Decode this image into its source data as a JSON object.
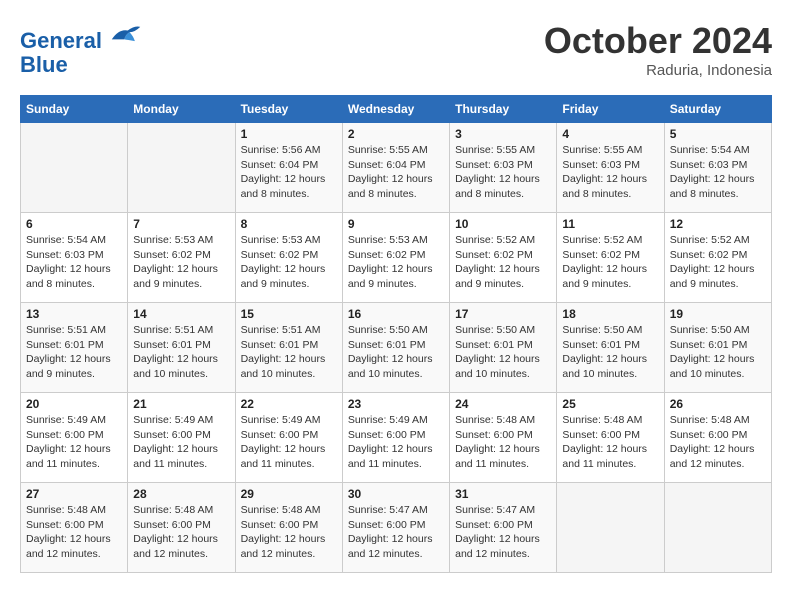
{
  "header": {
    "logo_line1": "General",
    "logo_line2": "Blue",
    "month": "October 2024",
    "location": "Raduria, Indonesia"
  },
  "weekdays": [
    "Sunday",
    "Monday",
    "Tuesday",
    "Wednesday",
    "Thursday",
    "Friday",
    "Saturday"
  ],
  "weeks": [
    [
      {
        "day": "",
        "info": ""
      },
      {
        "day": "",
        "info": ""
      },
      {
        "day": "1",
        "info": "Sunrise: 5:56 AM\nSunset: 6:04 PM\nDaylight: 12 hours and 8 minutes."
      },
      {
        "day": "2",
        "info": "Sunrise: 5:55 AM\nSunset: 6:04 PM\nDaylight: 12 hours and 8 minutes."
      },
      {
        "day": "3",
        "info": "Sunrise: 5:55 AM\nSunset: 6:03 PM\nDaylight: 12 hours and 8 minutes."
      },
      {
        "day": "4",
        "info": "Sunrise: 5:55 AM\nSunset: 6:03 PM\nDaylight: 12 hours and 8 minutes."
      },
      {
        "day": "5",
        "info": "Sunrise: 5:54 AM\nSunset: 6:03 PM\nDaylight: 12 hours and 8 minutes."
      }
    ],
    [
      {
        "day": "6",
        "info": "Sunrise: 5:54 AM\nSunset: 6:03 PM\nDaylight: 12 hours and 8 minutes."
      },
      {
        "day": "7",
        "info": "Sunrise: 5:53 AM\nSunset: 6:02 PM\nDaylight: 12 hours and 9 minutes."
      },
      {
        "day": "8",
        "info": "Sunrise: 5:53 AM\nSunset: 6:02 PM\nDaylight: 12 hours and 9 minutes."
      },
      {
        "day": "9",
        "info": "Sunrise: 5:53 AM\nSunset: 6:02 PM\nDaylight: 12 hours and 9 minutes."
      },
      {
        "day": "10",
        "info": "Sunrise: 5:52 AM\nSunset: 6:02 PM\nDaylight: 12 hours and 9 minutes."
      },
      {
        "day": "11",
        "info": "Sunrise: 5:52 AM\nSunset: 6:02 PM\nDaylight: 12 hours and 9 minutes."
      },
      {
        "day": "12",
        "info": "Sunrise: 5:52 AM\nSunset: 6:02 PM\nDaylight: 12 hours and 9 minutes."
      }
    ],
    [
      {
        "day": "13",
        "info": "Sunrise: 5:51 AM\nSunset: 6:01 PM\nDaylight: 12 hours and 9 minutes."
      },
      {
        "day": "14",
        "info": "Sunrise: 5:51 AM\nSunset: 6:01 PM\nDaylight: 12 hours and 10 minutes."
      },
      {
        "day": "15",
        "info": "Sunrise: 5:51 AM\nSunset: 6:01 PM\nDaylight: 12 hours and 10 minutes."
      },
      {
        "day": "16",
        "info": "Sunrise: 5:50 AM\nSunset: 6:01 PM\nDaylight: 12 hours and 10 minutes."
      },
      {
        "day": "17",
        "info": "Sunrise: 5:50 AM\nSunset: 6:01 PM\nDaylight: 12 hours and 10 minutes."
      },
      {
        "day": "18",
        "info": "Sunrise: 5:50 AM\nSunset: 6:01 PM\nDaylight: 12 hours and 10 minutes."
      },
      {
        "day": "19",
        "info": "Sunrise: 5:50 AM\nSunset: 6:01 PM\nDaylight: 12 hours and 10 minutes."
      }
    ],
    [
      {
        "day": "20",
        "info": "Sunrise: 5:49 AM\nSunset: 6:00 PM\nDaylight: 12 hours and 11 minutes."
      },
      {
        "day": "21",
        "info": "Sunrise: 5:49 AM\nSunset: 6:00 PM\nDaylight: 12 hours and 11 minutes."
      },
      {
        "day": "22",
        "info": "Sunrise: 5:49 AM\nSunset: 6:00 PM\nDaylight: 12 hours and 11 minutes."
      },
      {
        "day": "23",
        "info": "Sunrise: 5:49 AM\nSunset: 6:00 PM\nDaylight: 12 hours and 11 minutes."
      },
      {
        "day": "24",
        "info": "Sunrise: 5:48 AM\nSunset: 6:00 PM\nDaylight: 12 hours and 11 minutes."
      },
      {
        "day": "25",
        "info": "Sunrise: 5:48 AM\nSunset: 6:00 PM\nDaylight: 12 hours and 11 minutes."
      },
      {
        "day": "26",
        "info": "Sunrise: 5:48 AM\nSunset: 6:00 PM\nDaylight: 12 hours and 12 minutes."
      }
    ],
    [
      {
        "day": "27",
        "info": "Sunrise: 5:48 AM\nSunset: 6:00 PM\nDaylight: 12 hours and 12 minutes."
      },
      {
        "day": "28",
        "info": "Sunrise: 5:48 AM\nSunset: 6:00 PM\nDaylight: 12 hours and 12 minutes."
      },
      {
        "day": "29",
        "info": "Sunrise: 5:48 AM\nSunset: 6:00 PM\nDaylight: 12 hours and 12 minutes."
      },
      {
        "day": "30",
        "info": "Sunrise: 5:47 AM\nSunset: 6:00 PM\nDaylight: 12 hours and 12 minutes."
      },
      {
        "day": "31",
        "info": "Sunrise: 5:47 AM\nSunset: 6:00 PM\nDaylight: 12 hours and 12 minutes."
      },
      {
        "day": "",
        "info": ""
      },
      {
        "day": "",
        "info": ""
      }
    ]
  ]
}
